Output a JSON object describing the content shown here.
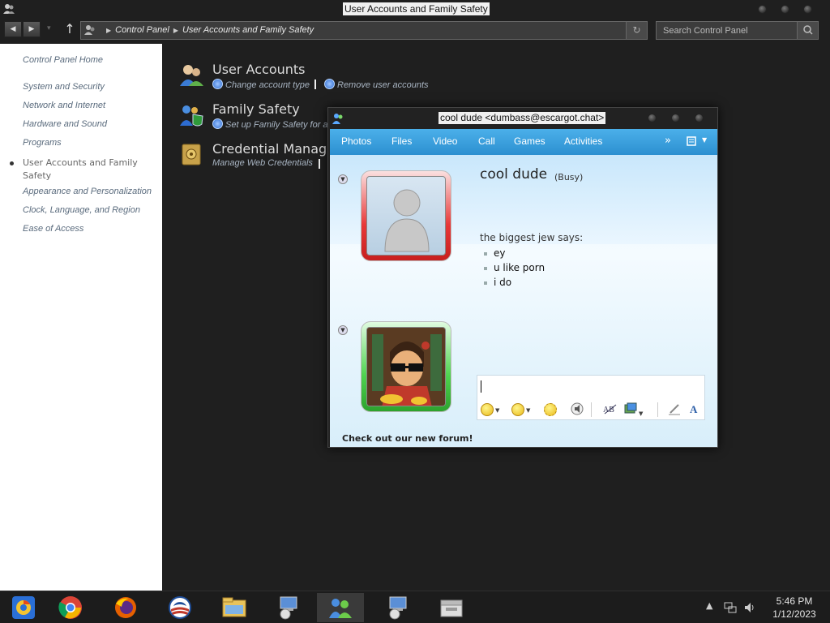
{
  "window": {
    "title": "User Accounts and Family Safety"
  },
  "address_bar": {
    "crumbs": [
      "Control Panel",
      "User Accounts and Family Safety"
    ],
    "search_placeholder": "Search Control Panel"
  },
  "left_pane": {
    "home": "Control Panel Home",
    "links": [
      "System and Security",
      "Network and Internet",
      "Hardware and Sound",
      "Programs",
      "User Accounts and Family Safety",
      "Appearance and Personalization",
      "Clock, Language, and Region",
      "Ease of Access"
    ],
    "current_index": 4
  },
  "categories": [
    {
      "title": "User Accounts",
      "tasks": [
        "Change account type",
        "Remove user accounts"
      ]
    },
    {
      "title": "Family Safety",
      "tasks": [
        "Set up Family Safety for a"
      ]
    },
    {
      "title": "Credential Manager",
      "tasks": [
        "Manage Web Credentials"
      ]
    }
  ],
  "chat": {
    "title": "cool dude <dumbass@escargot.chat>",
    "toolbar": [
      "Photos",
      "Files",
      "Video",
      "Call",
      "Games",
      "Activities"
    ],
    "more_label": "»",
    "contact_name": "cool dude",
    "contact_status": "(Busy)",
    "says_label": "the biggest jew says:",
    "messages": [
      "ey",
      "u like porn",
      "i do"
    ],
    "compose_value": "",
    "promo": "Check out our new forum!",
    "colors": {
      "busy": "#e83838",
      "online": "#4fd34f",
      "toolbar": "#2c8fd0"
    }
  },
  "taskbar": {
    "apps": [
      "chrome-canary-icon",
      "chrome-icon",
      "firefox-icon",
      "obama-icon",
      "file-explorer-icon",
      "setup-icon",
      "messenger-icon",
      "setup-icon-2",
      "archive-icon"
    ],
    "active_index": 6,
    "time": "5:46 PM",
    "date": "1/12/2023"
  }
}
